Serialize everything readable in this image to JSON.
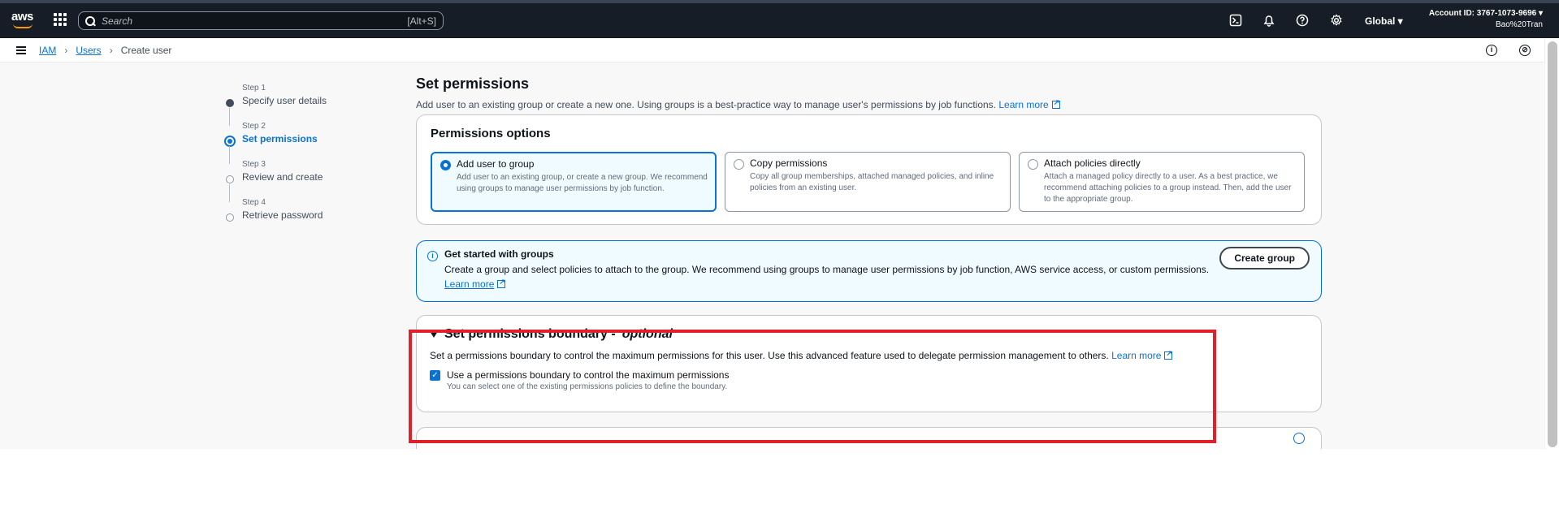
{
  "topbar": {
    "logo": "aws",
    "search_placeholder": "Search",
    "search_shortcut": "[Alt+S]",
    "icons": [
      "cloudshell-icon",
      "bell-icon",
      "help-icon",
      "gear-icon"
    ],
    "region": "Global ▾",
    "account_id": "Account ID: 3767-1073-9696 ▾",
    "user": "Bao%20Tran"
  },
  "breadcrumb": {
    "items": [
      "IAM",
      "Users",
      "Create user"
    ]
  },
  "steps": [
    {
      "num": "Step 1",
      "title": "Specify user details",
      "state": "done"
    },
    {
      "num": "Step 2",
      "title": "Set permissions",
      "state": "active"
    },
    {
      "num": "Step 3",
      "title": "Review and create",
      "state": "pending"
    },
    {
      "num": "Step 4",
      "title": "Retrieve password",
      "state": "pending"
    }
  ],
  "page": {
    "title": "Set permissions",
    "description": "Add user to an existing group or create a new one. Using groups is a best-practice way to manage user's permissions by job functions.",
    "learn_more": "Learn more"
  },
  "permissions_options": {
    "title": "Permissions options",
    "options": [
      {
        "label": "Add user to group",
        "desc": "Add user to an existing group, or create a new group. We recommend using groups to manage user permissions by job function.",
        "selected": true
      },
      {
        "label": "Copy permissions",
        "desc": "Copy all group memberships, attached managed policies, and inline policies from an existing user.",
        "selected": false
      },
      {
        "label": "Attach policies directly",
        "desc": "Attach a managed policy directly to a user. As a best practice, we recommend attaching policies to a group instead. Then, add the user to the appropriate group.",
        "selected": false
      }
    ]
  },
  "info": {
    "title": "Get started with groups",
    "description": "Create a group and select policies to attach to the group. We recommend using groups to manage user permissions by job function, AWS service access, or custom permissions.",
    "learn_more": "Learn more",
    "button": "Create group"
  },
  "boundary": {
    "title": "Set permissions boundary -",
    "title_optional": "optional",
    "description": "Set a permissions boundary to control the maximum permissions for this user. Use this advanced feature used to delegate permission management to others.",
    "learn_more": "Learn more",
    "checkbox_label": "Use a permissions boundary to control the maximum permissions",
    "checkbox_desc": "You can select one of the existing permissions policies to define the boundary.",
    "checked": true
  },
  "colors": {
    "accent": "#0972d3",
    "topbar": "#161d26",
    "highlight": "#e0202a"
  }
}
